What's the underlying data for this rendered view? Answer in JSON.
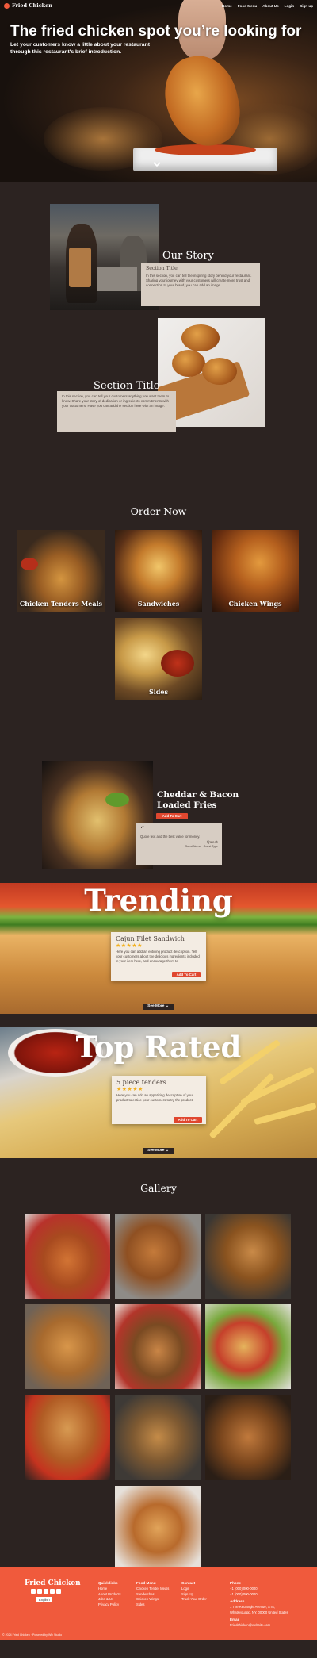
{
  "nav": {
    "brand": "Fried Chicken",
    "links": [
      "Home",
      "Food Menu",
      "About Us",
      "Login",
      "Sign up"
    ]
  },
  "hero": {
    "title": "The fried chicken spot you’re looking for",
    "subtitle": "Let your customers know a little about your restaurant through this restaurant's brief introduction.",
    "scroll_icon": "chevron-down-icon"
  },
  "story": {
    "heading": "Our Story",
    "card1": {
      "title": "Section Title",
      "body": "In this section, you can tell the inspiring story behind your restaurant. Sharing your journey with your customers will create more trust and connection to your brand, you can add an image."
    },
    "heading2": "Section Title",
    "card2": {
      "body": "In this section, you can tell your customers anything you want them to know. Share your story of dedication or ingredients commitments with your customers. Have you can add the section here with an image."
    }
  },
  "order": {
    "heading": "Order Now",
    "items": [
      "Chicken Tenders Meals",
      "Sandwiches",
      "Chicken Wings",
      "Sides"
    ]
  },
  "featured": {
    "title": "Cheddar & Bacon Loaded Fries",
    "button": "Add To Cart",
    "quote": "Quote text and the best value for money.",
    "quote_name": "Quest",
    "quote_role": "Guest Name · Guest Type"
  },
  "trending": {
    "heading": "Trending",
    "item_title": "Cajun Filet Sandwich",
    "stars": "★★★★★",
    "description": "Here you can add an enticing product description. Tell your customers about the delicious ingredients included in your item here, and encourage them to",
    "button": "Add To Cart",
    "see_more": "See More"
  },
  "top_rated": {
    "heading": "Top Rated",
    "item_title": "5 piece tenders",
    "stars": "★★★★★",
    "description": "Here you can add an appetizing description of your product to entice your customers to try the product",
    "button": "Add To Cart",
    "see_more": "See More"
  },
  "gallery": {
    "heading": "Gallery"
  },
  "footer": {
    "brand": "Fried Chicken",
    "language": "English",
    "col1": {
      "heading": "Quick links",
      "links": [
        "Home",
        "About Products",
        "Jobs & Us",
        "Privacy Policy"
      ]
    },
    "col2": {
      "heading": "Food Menu",
      "links": [
        "Chicken Tender Meals",
        "Sandwiches",
        "Chicken Wings",
        "Sides"
      ]
    },
    "col3": {
      "heading": "Contact",
      "links": [
        "Login",
        "Sign Up",
        "Track Your Order"
      ]
    },
    "col4": {
      "phone_heading": "Phone",
      "phone1": "+1 (000) 000-0000",
      "phone2": "+1 (000) 000-0000",
      "address_heading": "Address",
      "address": "1 The Rectangle Avenue, STE, Whatsyouapp, NY, 00000 United States",
      "email_heading": "Email",
      "email": "Friedchicken@website.com"
    },
    "copyright": "© 2024 Fried Chicken · Powered by Wix Studio"
  }
}
